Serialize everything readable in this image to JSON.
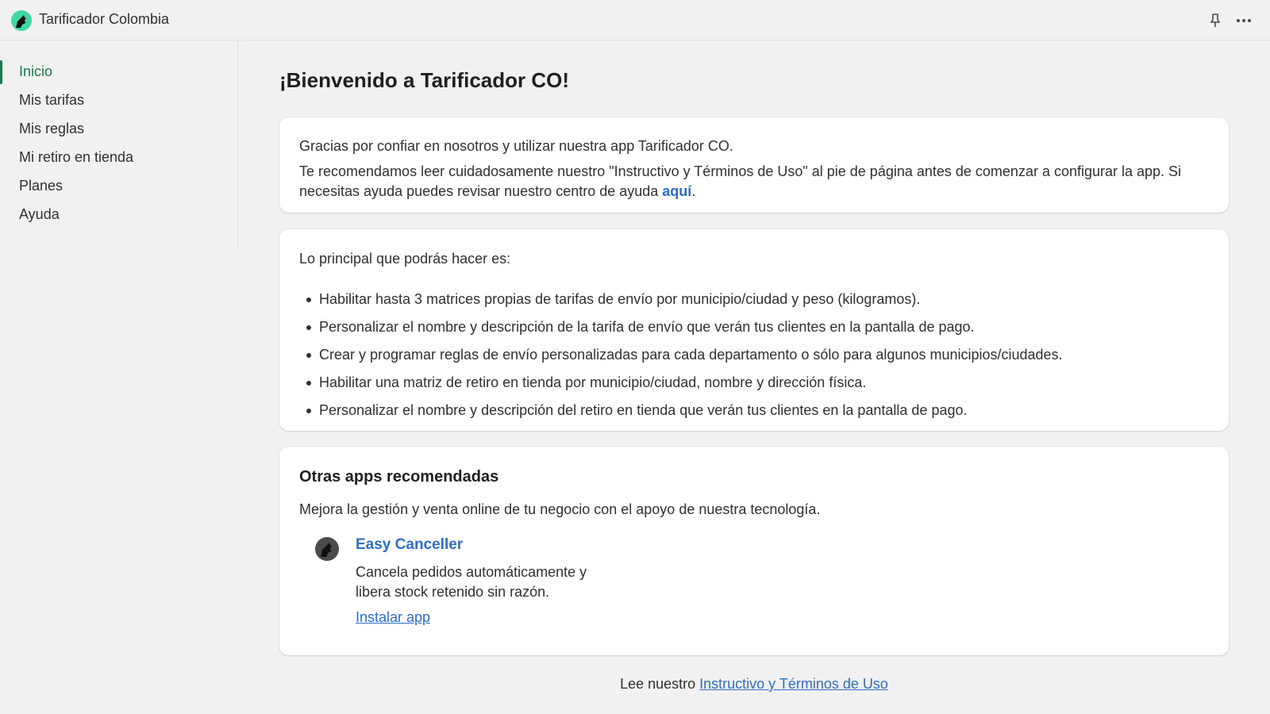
{
  "app": {
    "title": "Tarificador Colombia",
    "logo_icon": "wolf-logo-icon",
    "accent": "#1a7a4c",
    "link_color": "#2c6ecb"
  },
  "topbar": {
    "pin_icon": "pin-icon",
    "more_icon": "more-horizontal-icon"
  },
  "sidebar": {
    "items": [
      {
        "label": "Inicio",
        "active": true
      },
      {
        "label": "Mis tarifas",
        "active": false
      },
      {
        "label": "Mis reglas",
        "active": false
      },
      {
        "label": "Mi retiro en tienda",
        "active": false
      },
      {
        "label": "Planes",
        "active": false
      },
      {
        "label": "Ayuda",
        "active": false
      }
    ]
  },
  "main": {
    "title": "¡Bienvenido a Tarificador CO!",
    "welcome_card": {
      "line1": "Gracias por confiar en nosotros y utilizar nuestra app Tarificador CO.",
      "line2_before": "Te recomendamos leer cuidadosamente nuestro \"Instructivo y Términos de Uso\" al pie de página antes de comenzar a configurar la app. Si necesitas ayuda puedes revisar nuestro centro de ayuda ",
      "line2_link": "aquí",
      "line2_after": "."
    },
    "features_card": {
      "intro": "Lo principal que podrás hacer es:",
      "items": [
        "Habilitar hasta 3 matrices propias de tarifas de envío por municipio/ciudad y peso (kilogramos).",
        "Personalizar el nombre y descripción de la tarifa de envío que verán tus clientes en la pantalla de pago.",
        "Crear y programar reglas de envío personalizadas para cada departamento o sólo para algunos municipios/ciudades.",
        "Habilitar una matriz de retiro en tienda por municipio/ciudad, nombre y dirección física.",
        "Personalizar el nombre y descripción del retiro en tienda que verán tus clientes en la pantalla de pago."
      ]
    },
    "recommended_card": {
      "heading": "Otras apps recomendadas",
      "subtitle": "Mejora la gestión y venta online de tu negocio con el apoyo de nuestra tecnología.",
      "app_name": "Easy Canceller",
      "app_desc": "Cancela pedidos automáticamente y libera stock retenido sin razón.",
      "install_label": "Instalar app"
    }
  },
  "footer": {
    "prefix": "Lee nuestro ",
    "link": "Instructivo y Términos de Uso"
  }
}
